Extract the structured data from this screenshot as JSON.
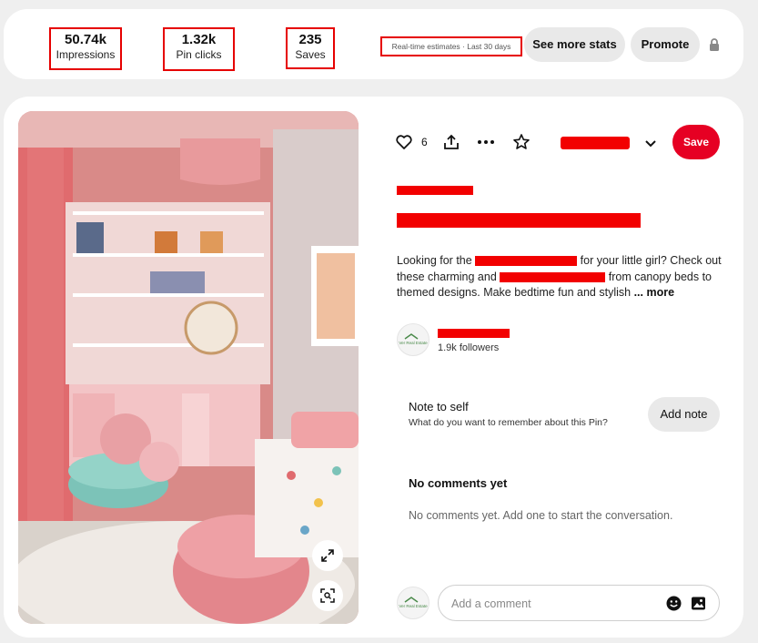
{
  "stats": {
    "impressions": {
      "value": "50.74k",
      "label": "Impressions"
    },
    "pin_clicks": {
      "value": "1.32k",
      "label": "Pin clicks"
    },
    "saves": {
      "value": "235",
      "label": "Saves"
    },
    "estimate_note": "Real-time estimates · Last 30 days",
    "see_more_label": "See more stats",
    "promote_label": "Promote"
  },
  "pin": {
    "reaction_count": "6",
    "save_label": "Save",
    "description_parts": [
      "Looking for the ",
      " for your little girl? Check out these charming and ",
      " from canopy beds to themed designs. Make bedtime fun and stylish"
    ],
    "more_label": "... more",
    "creator_followers": "1.9k followers",
    "avatar_text": "Ver Real Estate"
  },
  "note": {
    "title": "Note to self",
    "subtitle": "What do you want to remember about this Pin?",
    "add_label": "Add note"
  },
  "comments": {
    "title": "No comments yet",
    "empty_text": "No comments yet. Add one to start the conversation.",
    "input_placeholder": "Add a comment"
  },
  "colors": {
    "save_red": "#e60023",
    "redaction_red": "#f20000",
    "highlight_box": "#e60000",
    "pill_gray": "#e9e9e9"
  },
  "icons": [
    "heart-icon",
    "share-icon",
    "more-dots-icon",
    "star-icon",
    "chevron-down-icon",
    "lock-icon",
    "expand-icon",
    "visual-search-icon",
    "emoji-icon",
    "image-icon"
  ]
}
